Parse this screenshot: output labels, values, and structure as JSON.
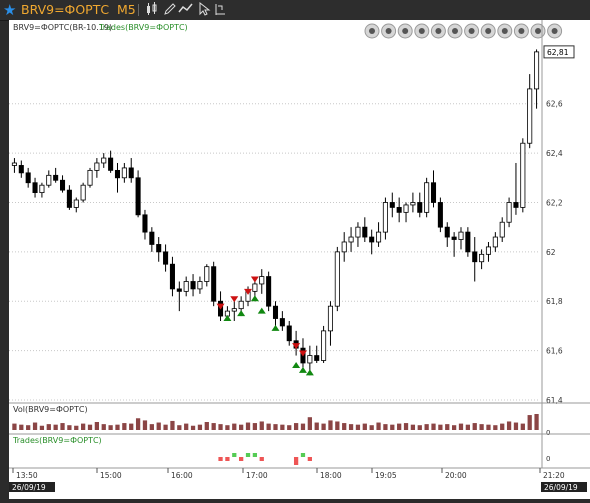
{
  "app": {
    "symbol": "BRV9=ФОРТС",
    "timeframe": "M5",
    "toolbar_icons": [
      "candlestick-chart-icon",
      "pencil-icon",
      "indicators-icon",
      "cursor-icon",
      "pin-icon"
    ]
  },
  "chart": {
    "legend_left": "BRV9=ФОРТС(BR-10.19)",
    "legend_right": "Trades(BRV9=ФОРТС)",
    "nav_buttons": [
      "rewind-start-icon",
      "step-back-fast-icon",
      "step-back-icon",
      "step-forward-icon",
      "step-forward-fast-icon",
      "zoom-in-icon",
      "zoom-out-icon",
      "zoom-fit-icon",
      "shrink-horizontal-icon",
      "expand-horizontal-icon",
      "auto-scale-icon",
      "collapse-up-icon"
    ],
    "price_ticks": [
      "62,6",
      "62,4",
      "62,2",
      "62",
      "61,8",
      "61,6",
      "61,4"
    ],
    "last_price": "62,81",
    "colors": {
      "up": "#ffffff",
      "down": "#000000",
      "buy": "#cc1111",
      "sell": "#118811",
      "volume": "#8b4545",
      "accent": "#f0a830"
    }
  },
  "volume_panel": {
    "label": "Vol(BRV9=ФОРТС)",
    "tick": "0"
  },
  "trades_panel": {
    "label": "Trades(BRV9=ФОРТС)",
    "tick": "0"
  },
  "time_axis": {
    "labels": [
      "13:50",
      "15:00",
      "16:00",
      "17:00",
      "18:00",
      "19:05",
      "20:00",
      "21:20"
    ],
    "start_date": "26/09/19",
    "end_date": "26/09/19"
  },
  "chart_data": {
    "type": "candlestick",
    "ylim": [
      61.4,
      62.85
    ],
    "ohlc": [
      [
        62.35,
        62.38,
        62.32,
        62.36
      ],
      [
        62.35,
        62.37,
        62.3,
        62.32
      ],
      [
        62.32,
        62.34,
        62.26,
        62.28
      ],
      [
        62.28,
        62.3,
        62.22,
        62.24
      ],
      [
        62.24,
        62.28,
        62.22,
        62.27
      ],
      [
        62.27,
        62.33,
        62.26,
        62.31
      ],
      [
        62.31,
        62.34,
        62.28,
        62.29
      ],
      [
        62.29,
        62.31,
        62.24,
        62.25
      ],
      [
        62.25,
        62.27,
        62.17,
        62.18
      ],
      [
        62.18,
        62.22,
        62.16,
        62.21
      ],
      [
        62.21,
        62.28,
        62.2,
        62.27
      ],
      [
        62.27,
        62.34,
        62.26,
        62.33
      ],
      [
        62.33,
        62.38,
        62.3,
        62.36
      ],
      [
        62.36,
        62.4,
        62.34,
        62.38
      ],
      [
        62.38,
        62.41,
        62.32,
        62.33
      ],
      [
        62.33,
        62.36,
        62.24,
        62.3
      ],
      [
        62.3,
        62.36,
        62.28,
        62.34
      ],
      [
        62.34,
        62.38,
        62.28,
        62.3
      ],
      [
        62.3,
        62.33,
        62.14,
        62.15
      ],
      [
        62.15,
        62.17,
        62.05,
        62.08
      ],
      [
        62.08,
        62.1,
        62.0,
        62.03
      ],
      [
        62.03,
        62.06,
        61.96,
        62.0
      ],
      [
        62.0,
        62.03,
        61.92,
        61.95
      ],
      [
        61.95,
        61.98,
        61.82,
        61.85
      ],
      [
        61.85,
        61.88,
        61.76,
        61.84
      ],
      [
        61.84,
        61.9,
        61.82,
        61.88
      ],
      [
        61.88,
        61.91,
        61.82,
        61.85
      ],
      [
        61.85,
        61.9,
        61.83,
        61.88
      ],
      [
        61.88,
        61.95,
        61.86,
        61.94
      ],
      [
        61.94,
        61.96,
        61.78,
        61.8
      ],
      [
        61.8,
        61.84,
        61.72,
        61.74
      ],
      [
        61.74,
        61.78,
        61.72,
        61.76
      ],
      [
        61.76,
        61.8,
        61.72,
        61.77
      ],
      [
        61.77,
        61.82,
        61.74,
        61.8
      ],
      [
        61.8,
        61.86,
        61.78,
        61.84
      ],
      [
        61.84,
        61.9,
        61.8,
        61.87
      ],
      [
        61.87,
        61.93,
        61.83,
        61.9
      ],
      [
        61.9,
        61.92,
        61.76,
        61.78
      ],
      [
        61.78,
        61.8,
        61.7,
        61.73
      ],
      [
        61.73,
        61.76,
        61.68,
        61.7
      ],
      [
        61.7,
        61.72,
        61.62,
        61.64
      ],
      [
        61.64,
        61.68,
        61.58,
        61.61
      ],
      [
        61.61,
        61.65,
        61.52,
        61.55
      ],
      [
        61.55,
        61.62,
        61.5,
        61.58
      ],
      [
        61.58,
        61.62,
        61.55,
        61.56
      ],
      [
        61.56,
        61.7,
        61.55,
        61.68
      ],
      [
        61.68,
        61.8,
        61.62,
        61.78
      ],
      [
        61.78,
        62.02,
        61.76,
        62.0
      ],
      [
        62.0,
        62.08,
        61.96,
        62.04
      ],
      [
        62.04,
        62.1,
        62.0,
        62.06
      ],
      [
        62.06,
        62.12,
        62.02,
        62.1
      ],
      [
        62.1,
        62.14,
        62.04,
        62.06
      ],
      [
        62.06,
        62.09,
        61.99,
        62.04
      ],
      [
        62.04,
        62.12,
        62.02,
        62.08
      ],
      [
        62.08,
        62.22,
        62.05,
        62.2
      ],
      [
        62.2,
        62.24,
        62.14,
        62.18
      ],
      [
        62.18,
        62.22,
        62.12,
        62.16
      ],
      [
        62.16,
        62.2,
        62.12,
        62.19
      ],
      [
        62.19,
        62.24,
        62.16,
        62.2
      ],
      [
        62.2,
        62.24,
        62.14,
        62.16
      ],
      [
        62.16,
        62.3,
        62.14,
        62.28
      ],
      [
        62.28,
        62.33,
        62.18,
        62.2
      ],
      [
        62.2,
        62.22,
        62.08,
        62.1
      ],
      [
        62.1,
        62.12,
        62.02,
        62.06
      ],
      [
        62.06,
        62.08,
        61.98,
        62.05
      ],
      [
        62.05,
        62.1,
        62.01,
        62.08
      ],
      [
        62.08,
        62.1,
        61.98,
        62.0
      ],
      [
        62.0,
        62.06,
        61.88,
        61.96
      ],
      [
        61.96,
        62.01,
        61.93,
        61.99
      ],
      [
        61.99,
        62.04,
        61.96,
        62.02
      ],
      [
        62.02,
        62.08,
        62.0,
        62.06
      ],
      [
        62.06,
        62.14,
        62.04,
        62.12
      ],
      [
        62.12,
        62.22,
        62.1,
        62.2
      ],
      [
        62.2,
        62.36,
        62.15,
        62.18
      ],
      [
        62.18,
        62.46,
        62.16,
        62.44
      ],
      [
        62.44,
        62.72,
        62.42,
        62.66
      ],
      [
        62.66,
        62.82,
        62.58,
        62.81
      ]
    ],
    "volumes": [
      12,
      10,
      9,
      14,
      8,
      11,
      10,
      13,
      9,
      8,
      12,
      10,
      15,
      11,
      9,
      10,
      13,
      12,
      22,
      18,
      11,
      14,
      10,
      17,
      9,
      12,
      8,
      10,
      15,
      13,
      11,
      9,
      12,
      10,
      14,
      13,
      16,
      12,
      11,
      10,
      9,
      13,
      12,
      24,
      14,
      12,
      18,
      16,
      13,
      11,
      10,
      12,
      9,
      14,
      11,
      10,
      12,
      13,
      10,
      9,
      11,
      12,
      10,
      11,
      9,
      12,
      10,
      13,
      11,
      10,
      9,
      12,
      16,
      14,
      12,
      28,
      30
    ],
    "trades": {
      "buy": [
        [
          30,
          61.77
        ],
        [
          32,
          61.8
        ],
        [
          34,
          61.83
        ],
        [
          35,
          61.88
        ],
        [
          41,
          61.61
        ],
        [
          42,
          61.58
        ]
      ],
      "sell": [
        [
          31,
          61.74
        ],
        [
          33,
          61.76
        ],
        [
          35,
          61.82
        ],
        [
          36,
          61.77
        ],
        [
          38,
          61.7
        ],
        [
          41,
          61.55
        ],
        [
          42,
          61.53
        ],
        [
          43,
          61.52
        ]
      ]
    },
    "trade_bars": [
      [
        30,
        -1
      ],
      [
        31,
        -1
      ],
      [
        32,
        1
      ],
      [
        33,
        -1
      ],
      [
        34,
        1
      ],
      [
        35,
        1
      ],
      [
        36,
        -1
      ],
      [
        41,
        -2
      ],
      [
        42,
        1
      ],
      [
        43,
        -1
      ]
    ]
  }
}
